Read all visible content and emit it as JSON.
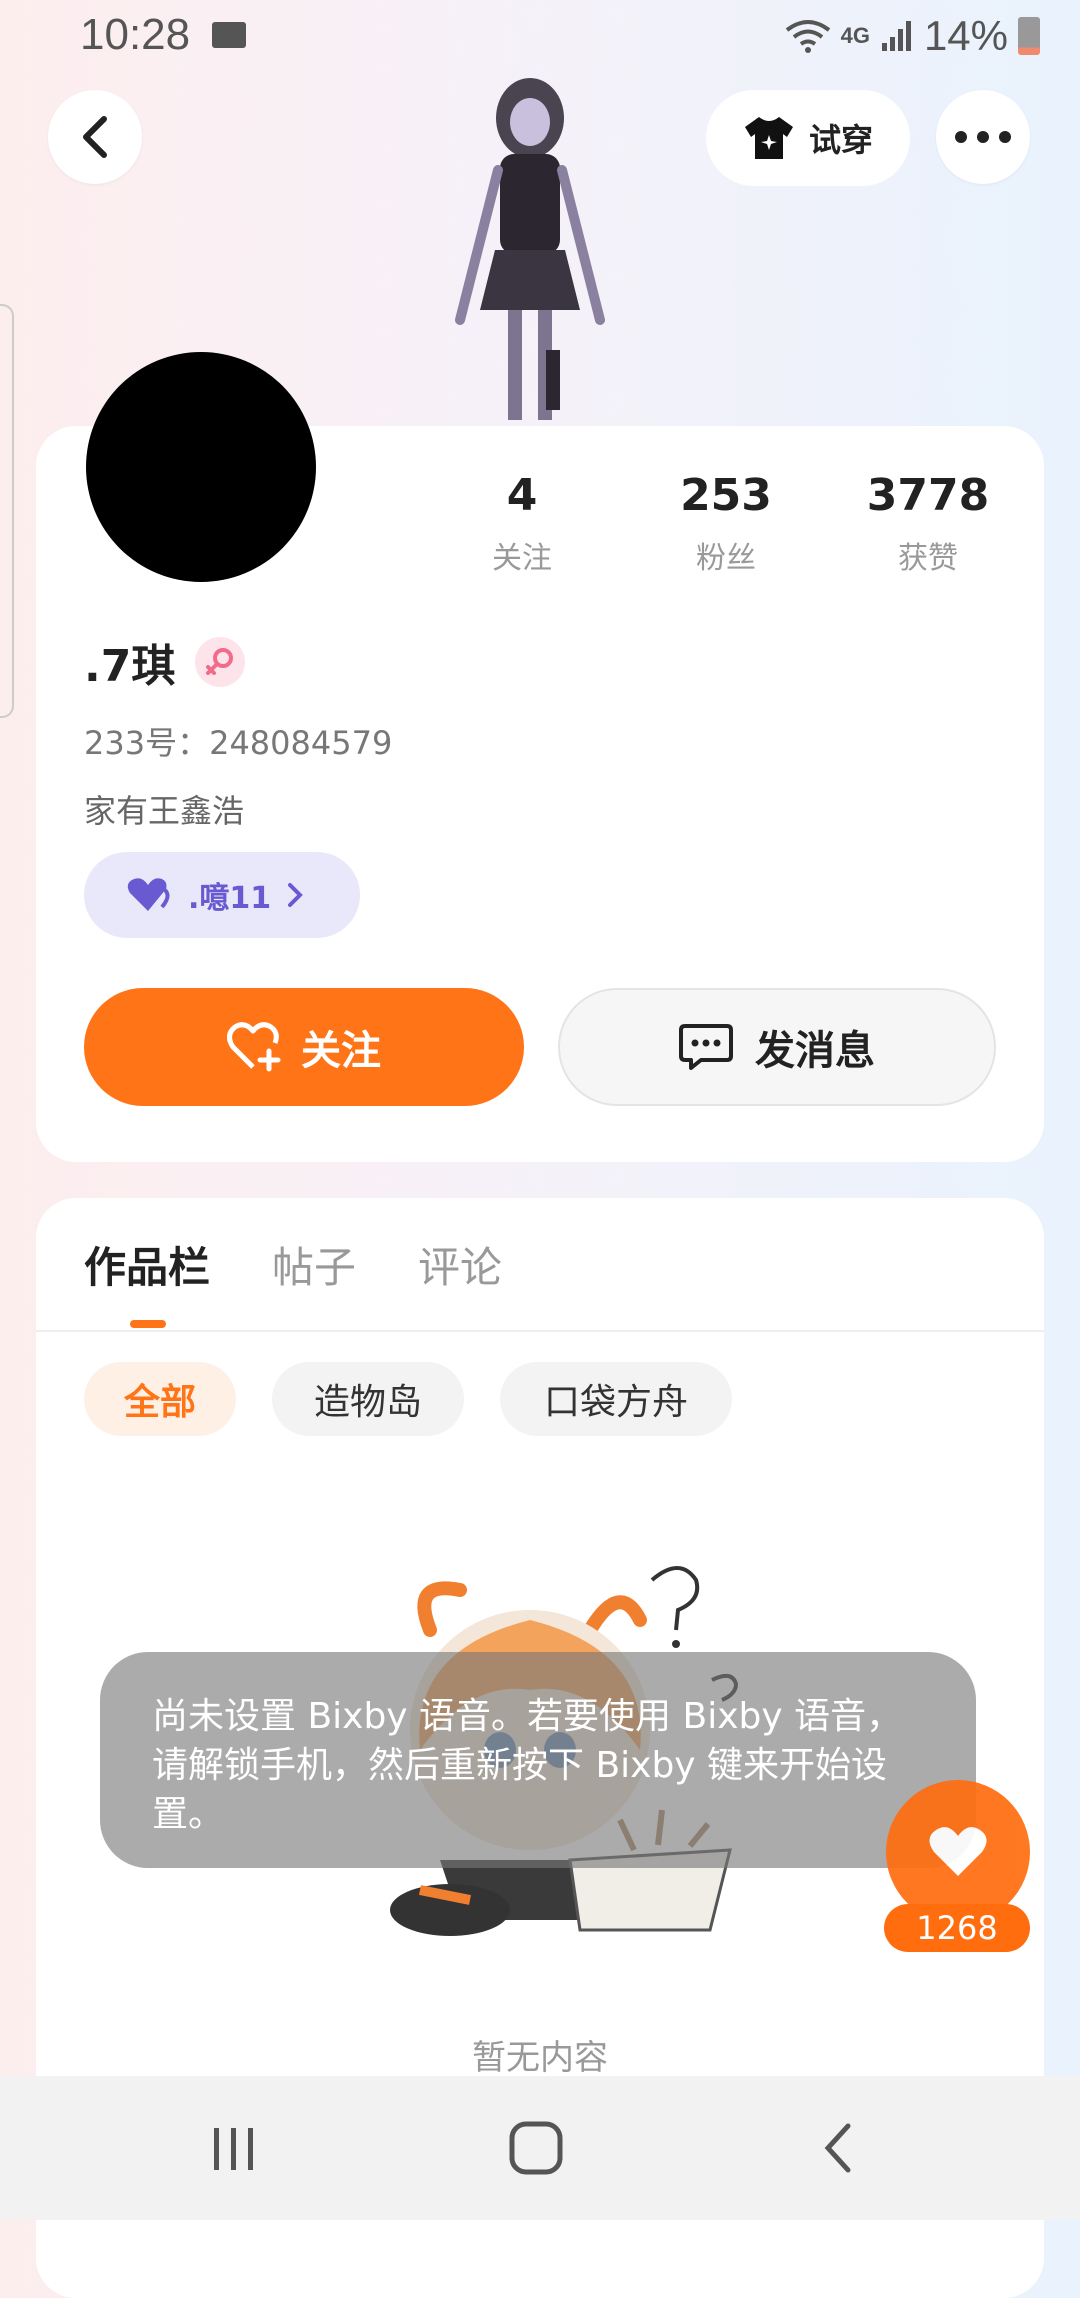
{
  "status_bar": {
    "time": "10:28",
    "network": "4G",
    "battery": "14%"
  },
  "header": {
    "try_on_label": "试穿",
    "icons": [
      "back-icon",
      "shirt-icon",
      "more-icon"
    ]
  },
  "profile": {
    "stats": [
      {
        "value": "4",
        "label": "关注"
      },
      {
        "value": "253",
        "label": "粉丝"
      },
      {
        "value": "3778",
        "label": "获赞"
      }
    ],
    "username": ".7琪",
    "uid": "233号：248084579",
    "bio": "家有王鑫浩",
    "tag": ".噫11",
    "follow_label": "关注",
    "message_label": "发消息"
  },
  "tabs": [
    {
      "label": "作品栏",
      "active": true
    },
    {
      "label": "帖子",
      "active": false
    },
    {
      "label": "评论",
      "active": false
    }
  ],
  "filters": [
    {
      "label": "全部",
      "active": true
    },
    {
      "label": "造物岛",
      "active": false
    },
    {
      "label": "口袋方舟",
      "active": false
    }
  ],
  "empty_text": "暂无内容",
  "toast": "尚未设置 Bixby 语音。若要使用 Bixby 语音，请解锁手机，然后重新按下 Bixby 键来开始设置。",
  "like": {
    "count": "1268"
  },
  "colors": {
    "accent": "#ff7417",
    "tag_bg": "#e9e7fa",
    "tag_text": "#6a5ad1"
  }
}
